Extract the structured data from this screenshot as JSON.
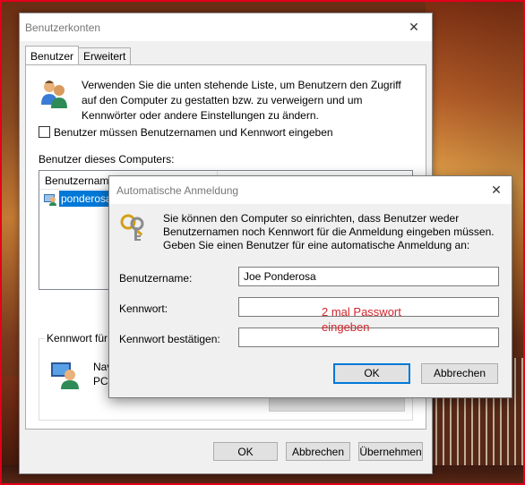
{
  "main_window": {
    "title": "Benutzerkonten",
    "close_glyph": "✕",
    "tabs": [
      "Benutzer",
      "Erweitert"
    ],
    "intro_text": "Verwenden Sie die unten stehende Liste, um Benutzern den Zugriff auf den Computer zu gestatten bzw. zu verweigern und um Kennwörter oder andere Einstellungen zu ändern.",
    "require_password_checkbox": "Benutzer müssen Benutzernamen und Kennwort eingeben",
    "users_section_label": "Benutzer dieses Computers:",
    "list_header": "Benutzernam",
    "selected_user": "ponderosa",
    "password_group_label": "Kennwort für",
    "password_group_text_1": "Nav",
    "password_group_text_2": "PC-",
    "buttons": {
      "ok": "OK",
      "cancel": "Abbrechen",
      "apply": "Übernehmen"
    }
  },
  "dialog": {
    "title": "Automatische Anmeldung",
    "close_glyph": "✕",
    "text": "Sie können den Computer so einrichten, dass Benutzer weder Benutzernamen noch Kennwort für die Anmeldung eingeben müssen. Geben Sie einen Benutzer für eine automatische Anmeldung an:",
    "username_label": "Benutzername:",
    "username_value": "Joe Ponderosa",
    "password_label": "Kennwort:",
    "password_value": "",
    "confirm_label": "Kennwort bestätigen:",
    "confirm_value": "",
    "annotation_line1": "2 mal Passwort",
    "annotation_line2": "eingeben",
    "buttons": {
      "ok": "OK",
      "cancel": "Abbrechen"
    }
  },
  "colors": {
    "selection": "#0078d7",
    "annotation": "#d0262c",
    "frame": "#e3001b"
  },
  "icons": [
    "users-icon",
    "user-small-icon",
    "user-large-icon",
    "keys-icon",
    "close-icon"
  ]
}
